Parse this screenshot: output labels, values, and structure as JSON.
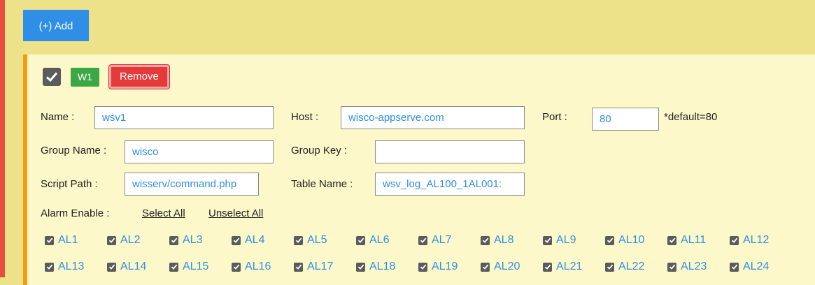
{
  "toolbar": {
    "add_label": "(+) Add"
  },
  "card": {
    "tag": "W1",
    "remove_label": "Remove",
    "fields": {
      "name_label": "Name :",
      "name_value": "wsv1",
      "host_label": "Host :",
      "host_value": "wisco-appserve.com",
      "port_label": "Port :",
      "port_value": "80",
      "port_hint": "*default=80",
      "group_name_label": "Group Name :",
      "group_name_value": "wisco",
      "group_key_label": "Group Key :",
      "group_key_value": "",
      "script_path_label": "Script Path :",
      "script_path_value": "wisserv/command.php",
      "table_name_label": "Table Name :",
      "table_name_value": "wsv_log_AL100_1AL001:"
    },
    "alarm": {
      "label": "Alarm Enable :",
      "select_all": "Select All",
      "unselect_all": "Unselect All",
      "items": [
        "AL1",
        "AL2",
        "AL3",
        "AL4",
        "AL5",
        "AL6",
        "AL7",
        "AL8",
        "AL9",
        "AL10",
        "AL11",
        "AL12",
        "AL13",
        "AL14",
        "AL15",
        "AL16",
        "AL17",
        "AL18",
        "AL19",
        "AL20",
        "AL21",
        "AL22",
        "AL23",
        "AL24"
      ]
    }
  },
  "colors": {
    "accent": "#2f8fe6",
    "left_bar": "#e74c3c",
    "card_border": "#f39c12",
    "tag": "#3ca745",
    "remove": "#e63a3a"
  }
}
